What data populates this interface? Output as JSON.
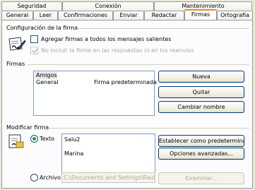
{
  "tabs_back": [
    "Seguridad",
    "Conexión",
    "Mantenimiento"
  ],
  "tabs_front": [
    "General",
    "Leer",
    "Confirmaciones",
    "Enviar",
    "Redactar",
    "Firmas",
    "Ortografía"
  ],
  "active_tab": "Firmas",
  "config_group": {
    "title": "Configuración de la firma",
    "add_signature_label": "Agregar firmas a todos los mensajes salientes",
    "add_signature_checked": false,
    "no_include_label": "No incluir la firma en las respuestas ni en los reenvíos",
    "no_include_checked": true
  },
  "firmas_group": {
    "title": "Firmas",
    "list": [
      {
        "name": "Amigos",
        "status": "",
        "selected": true
      },
      {
        "name": "General",
        "status": "Firma predeterminada",
        "selected": false
      }
    ],
    "new_button": "Nueva",
    "remove_button": "Quitar",
    "rename_button": "Cambiar nombre"
  },
  "modify_group": {
    "title": "Modificar firma",
    "text_radio_label": "Texto",
    "text_radio_checked": true,
    "signature_text_line1": "Salu2",
    "signature_text_line2": "Marina",
    "set_default_button": "Establecer como predeterminada",
    "advanced_button": "Opciones avanzadas...",
    "file_radio_label": "Archivo",
    "file_radio_checked": false,
    "file_path": "C:\\Documents and Settings\\Raul\\Mis",
    "browse_button": "Examinar..."
  }
}
